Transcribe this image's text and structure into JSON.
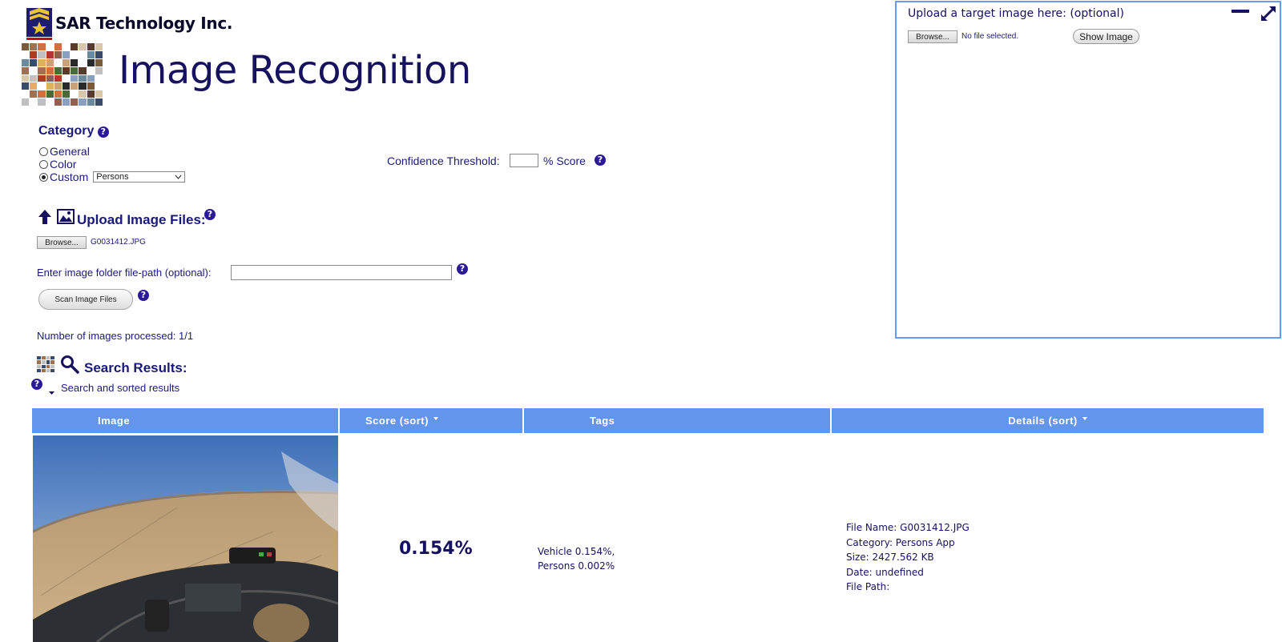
{
  "header": {
    "company_name": "SAR Technology Inc.",
    "page_title": "Image Recognition"
  },
  "category": {
    "heading": "Category",
    "options": [
      {
        "label": "General",
        "selected": false
      },
      {
        "label": "Color",
        "selected": false
      },
      {
        "label": "Custom",
        "selected": true
      }
    ],
    "custom_select_value": "Persons"
  },
  "confidence": {
    "label": "Confidence Threshold:",
    "value": "",
    "unit_label": "% Score"
  },
  "upload": {
    "heading": "Upload Image Files:",
    "browse_label": "Browse...",
    "selected_file": "G0031412.JPG",
    "folder_label": "Enter image folder file-path (optional):",
    "folder_value": "",
    "scan_label": "Scan Image Files",
    "processed_text": "Number of images processed: 1/1"
  },
  "results": {
    "heading": "Search Results:",
    "subheading": "Search and sorted results",
    "columns": [
      "Image",
      "Score (sort)",
      "Tags",
      "Details (sort)"
    ],
    "rows": [
      {
        "score": "0.154%",
        "tags": [
          "Vehicle 0.154%,",
          "Persons 0.002%"
        ],
        "details": [
          "File Name: G0031412.JPG",
          "Category: Persons App",
          "Size: 2427.562 KB",
          "Date: undefined",
          "File Path:"
        ]
      }
    ]
  },
  "target_panel": {
    "label": "Upload a target image here: (optional)",
    "browse_label": "Browse...",
    "file_status": "No file selected.",
    "show_image_label": "Show Image"
  },
  "help_mark": "?",
  "colors": {
    "header_blue": "#6495ed",
    "text_navy": "#16125e",
    "panel_border": "#6a9bee"
  },
  "icons": [
    "help-icon",
    "upload-arrow-icon",
    "image-icon",
    "search-icon",
    "minimize-icon",
    "expand-icon",
    "dropdown-caret-icon"
  ]
}
